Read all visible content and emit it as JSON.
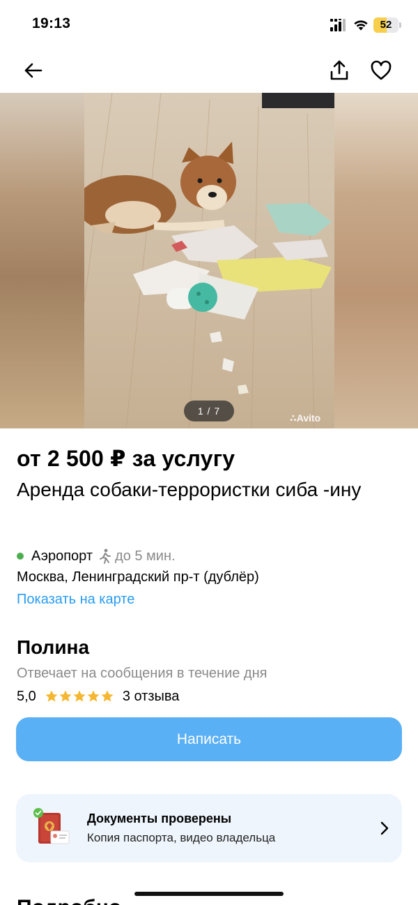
{
  "status_bar": {
    "time": "19:13",
    "battery_level": "52",
    "battery_percent": 52,
    "icons": [
      "cellular-signal-icon",
      "wifi-icon",
      "battery-icon"
    ]
  },
  "nav": {
    "back_icon": "arrow-left-icon",
    "share_icon": "share-icon",
    "favorite_icon": "heart-outline-icon"
  },
  "gallery": {
    "page_indicator": "1 / 7",
    "watermark": "Avito"
  },
  "listing": {
    "price": "от 2 500 ₽ за услугу",
    "title": "Аренда собаки-террористки сиба -ину"
  },
  "location": {
    "metro_station": "Аэропорт",
    "metro_color": "#4cae4f",
    "walk_time": "до 5 мин.",
    "address": "Москва, Ленинградский пр-т (дублёр)",
    "map_link": "Показать на карте"
  },
  "seller": {
    "name": "Полина",
    "reply_time": "Отвечает на сообщения в течение дня",
    "rating": "5,0",
    "stars": 5,
    "reviews": "3 отзыва"
  },
  "actions": {
    "write_button": "Написать"
  },
  "verification": {
    "title": "Документы проверены",
    "subtitle": "Копия паспорта, видео владельца"
  },
  "next_section_partial": "Подробно",
  "colors": {
    "accent": "#2a9cf2",
    "button": "#5ab0f5",
    "star": "#f5b731",
    "card_bg": "#eef5fc"
  }
}
